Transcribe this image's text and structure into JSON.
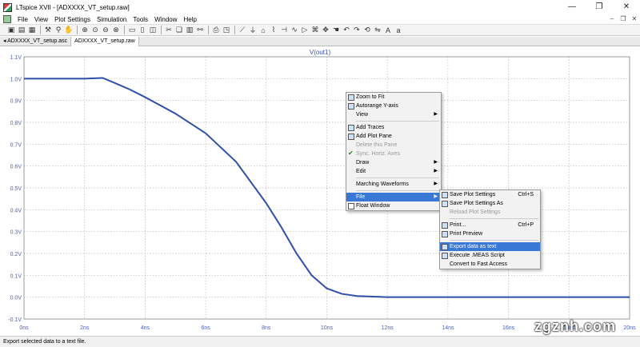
{
  "window": {
    "title": "LTspice XVII - [ADXXXX_VT_setup.raw]",
    "minimize": "—",
    "restore": "❐",
    "close": "✕"
  },
  "menu": [
    "File",
    "View",
    "Plot Settings",
    "Simulation",
    "Tools",
    "Window",
    "Help"
  ],
  "mdi_controls": [
    "–",
    "❐",
    "✕"
  ],
  "tabs": [
    {
      "label": "◂ ADXXXX_VT_setup.asc"
    },
    {
      "label": "ADXXXX_VT_setup.raw"
    }
  ],
  "chart_data": {
    "type": "line",
    "title": "V(out1)",
    "xlabel": "",
    "ylabel": "",
    "x_ticks": [
      "0ns",
      "2ns",
      "4ns",
      "6ns",
      "8ns",
      "10ns",
      "12ns",
      "14ns",
      "16ns",
      "18ns",
      "20ns"
    ],
    "y_ticks": [
      "1.1V",
      "1.0V",
      "0.9V",
      "0.8V",
      "0.7V",
      "0.6V",
      "0.5V",
      "0.4V",
      "0.3V",
      "0.2V",
      "0.1V",
      "0.0V",
      "-0.1V"
    ],
    "xlim": [
      0,
      20
    ],
    "ylim": [
      -0.1,
      1.1
    ],
    "grid": true,
    "line_color": "#2f4fa8",
    "series": [
      {
        "x": [
          0,
          1,
          2,
          2.6,
          3,
          3.5,
          4,
          5,
          6,
          7,
          8,
          8.5,
          9,
          9.5,
          10,
          10.5,
          11,
          12,
          14,
          16,
          18,
          20
        ],
        "y": [
          1.0,
          1.0,
          1.0,
          1.003,
          0.98,
          0.95,
          0.915,
          0.84,
          0.75,
          0.62,
          0.43,
          0.32,
          0.2,
          0.1,
          0.04,
          0.015,
          0.005,
          0.0,
          0.0,
          0.0,
          0.0,
          0.0
        ]
      }
    ]
  },
  "context_menu": {
    "items": [
      {
        "label": "Zoom to Fit",
        "icon": "zoom-fit-icon"
      },
      {
        "label": "Autorange Y-axis",
        "icon": "autorange-icon"
      },
      {
        "label": "View",
        "submenu": true
      },
      {
        "label": "Add Traces",
        "icon": "add-traces-icon"
      },
      {
        "label": "Add Plot Pane",
        "icon": "add-pane-icon"
      },
      {
        "label": "Delete this Pane",
        "disabled": true
      },
      {
        "label": "Sync. Horiz. Axes",
        "disabled": true,
        "checked": true
      },
      {
        "label": "Draw",
        "submenu": true
      },
      {
        "label": "Edit",
        "submenu": true
      },
      {
        "label": "Marching Waveforms",
        "submenu": true
      },
      {
        "label": "File",
        "submenu": true,
        "highlight": true
      },
      {
        "label": "Float Window",
        "checkbox": true
      }
    ]
  },
  "file_submenu": {
    "items": [
      {
        "label": "Save Plot Settings",
        "shortcut": "Ctrl+S"
      },
      {
        "label": "Save Plot Settings As",
        "shortcut": ""
      },
      {
        "label": "Reload Plot Settings",
        "shortcut": "",
        "disabled": true
      },
      {
        "label": "Print...",
        "shortcut": "Ctrl+P"
      },
      {
        "label": "Print Preview",
        "shortcut": ""
      },
      {
        "label": "Export data as text",
        "shortcut": "",
        "highlight": true
      },
      {
        "label": "Execute .MEAS Script",
        "shortcut": ""
      },
      {
        "label": "Convert to Fast Access",
        "shortcut": ""
      }
    ]
  },
  "status_bar": "Export selected data to a text file.",
  "watermark": "zgznh.com",
  "colors": {
    "grid": "#b8b8b8",
    "axis_text": "#4a5fc0",
    "highlight": "#3a78d6"
  }
}
